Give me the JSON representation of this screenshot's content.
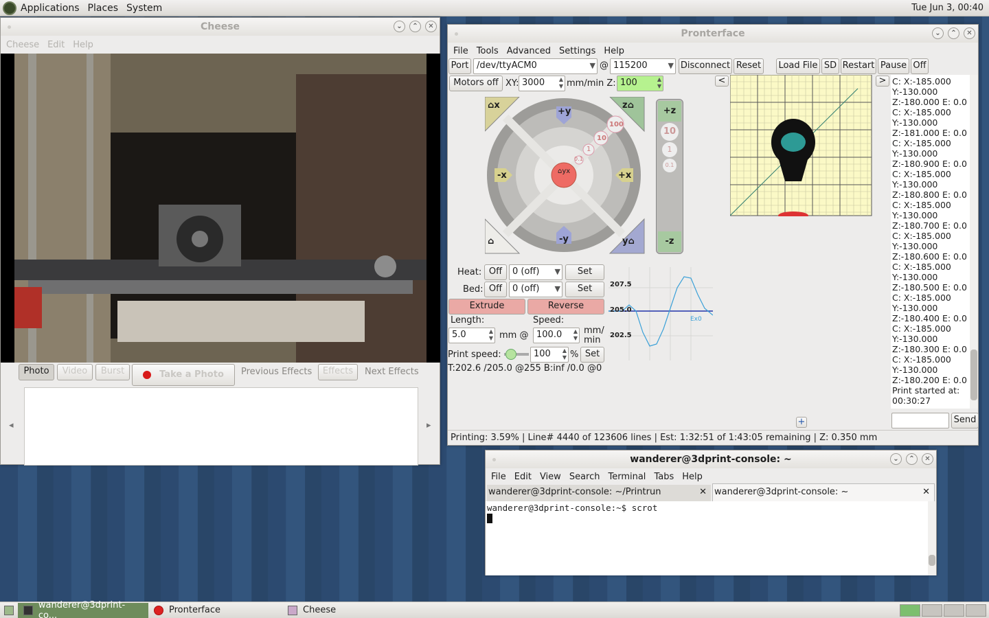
{
  "panel": {
    "menus": [
      "Applications",
      "Places",
      "System"
    ],
    "clock": "Tue Jun  3, 00:40"
  },
  "cheese": {
    "title": "Cheese",
    "menus": [
      "Cheese",
      "Edit",
      "Help"
    ],
    "buttons": {
      "photo": "Photo",
      "video": "Video",
      "burst": "Burst",
      "take": "Take a Photo",
      "prev": "Previous Effects",
      "effects": "Effects",
      "next": "Next Effects"
    }
  },
  "pronterface": {
    "title": "Pronterface",
    "menus": [
      "File",
      "Tools",
      "Advanced",
      "Settings",
      "Help"
    ],
    "port_label": "Port",
    "port_value": "/dev/ttyACM0",
    "at": "@",
    "baud": "115200",
    "buttons": {
      "disconnect": "Disconnect",
      "reset": "Reset",
      "load": "Load File",
      "sd": "SD",
      "restart": "Restart",
      "pause": "Pause",
      "off": "Off",
      "motors_off": "Motors off",
      "collapse_left": "<",
      "collapse_right": ">",
      "set_heat": "Set",
      "set_bed": "Set",
      "extrude": "Extrude",
      "reverse": "Reverse",
      "set_speed": "Set",
      "send": "Send",
      "plus": "+"
    },
    "xy_label": "XY:",
    "xy_value": "3000",
    "mmmin_z": "mm/min Z:",
    "z_value": "100",
    "jog": {
      "home_x": "x",
      "plus_y": "+y",
      "home_z": "z",
      "minus_x": "-x",
      "plus_x": "+x",
      "minus_y": "-y",
      "home_y": "y",
      "center_y": "y",
      "center_x": "x",
      "s100": "100",
      "s10": "10",
      "s1": "1",
      "s01": "0.1",
      "z_plus": "+z",
      "z_minus": "-z",
      "zs10": "10",
      "zs1": "1",
      "zs01": "0.1"
    },
    "heat_label": "Heat:",
    "heat_off": "Off",
    "heat_value": "0 (off)",
    "bed_label": "Bed:",
    "bed_off": "Off",
    "bed_value": "0 (off)",
    "length_label": "Length:",
    "speed_label": "Speed:",
    "length_value": "5.0",
    "mm_at": "mm @",
    "speed_value": "100.0",
    "mm_per": "mm/",
    "min": "min",
    "print_speed_label": "Print speed:",
    "print_speed_value": "100",
    "percent": "%",
    "temps": "T:202.6 /205.0 @255 B:inf /0.0 @0",
    "graph": {
      "labels": [
        "207.5",
        "205.0",
        "202.5"
      ],
      "ex0": "Ex0"
    },
    "log": [
      "C: X:-185.000",
      "Y:-130.000",
      "Z:-180.000 E: 0.0",
      "C: X:-185.000",
      "Y:-130.000",
      "Z:-181.000 E: 0.0",
      "C: X:-185.000",
      "Y:-130.000",
      "Z:-180.900 E: 0.0",
      "C: X:-185.000",
      "Y:-130.000",
      "Z:-180.800 E: 0.0",
      "C: X:-185.000",
      "Y:-130.000",
      "Z:-180.700 E: 0.0",
      "C: X:-185.000",
      "Y:-130.000",
      "Z:-180.600 E: 0.0",
      "C: X:-185.000",
      "Y:-130.000",
      "Z:-180.500 E: 0.0",
      "C: X:-185.000",
      "Y:-130.000",
      "Z:-180.400 E: 0.0",
      "C: X:-185.000",
      "Y:-130.000",
      "Z:-180.300 E: 0.0",
      "C: X:-185.000",
      "Y:-130.000",
      "Z:-180.200 E: 0.0",
      "Print started at:",
      "00:30:27"
    ],
    "status": "Printing: 3.59% | Line# 4440 of 123606 lines | Est: 1:32:51 of 1:43:05 remaining |  Z: 0.350 mm"
  },
  "terminal": {
    "title": "wanderer@3dprint-console: ~",
    "menus": [
      "File",
      "Edit",
      "View",
      "Search",
      "Terminal",
      "Tabs",
      "Help"
    ],
    "tabs": [
      "wanderer@3dprint-console: ~/Printrun",
      "wanderer@3dprint-console: ~"
    ],
    "prompt": "wanderer@3dprint-console:~$ scrot"
  },
  "taskbar": {
    "items": [
      "wanderer@3dprint-co...",
      "Pronterface",
      "Cheese"
    ]
  }
}
